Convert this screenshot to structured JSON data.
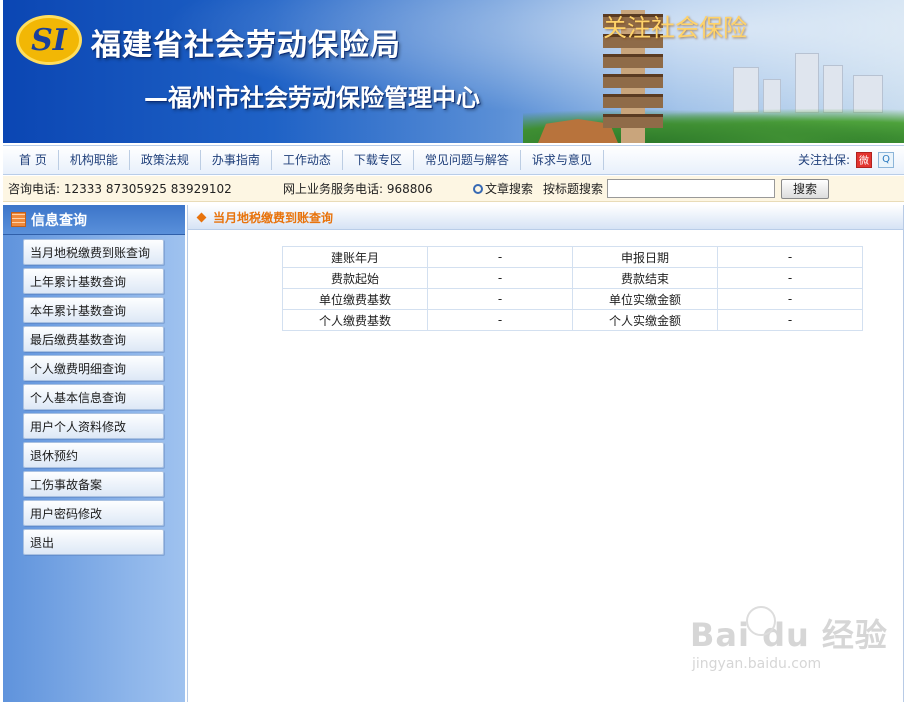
{
  "banner": {
    "logo_text": "SI",
    "title": "福建省社会劳动保险局",
    "subtitle": "—福州市社会劳动保险管理中心",
    "slogan": "关注社会保险"
  },
  "nav": {
    "items": [
      "首 页",
      "机构职能",
      "政策法规",
      "办事指南",
      "工作动态",
      "下载专区",
      "常见问题与解答",
      "诉求与意见"
    ],
    "follow_label": "关注社保:"
  },
  "info_bar": {
    "consult_phone": "咨询电话: 12333 87305925 83929102",
    "service_phone": "网上业务服务电话: 968806",
    "article_search": "文章搜索",
    "title_search_label": "按标题搜索",
    "search_value": "",
    "search_button": "搜索"
  },
  "sidebar": {
    "title": "信息查询",
    "items": [
      "当月地税缴费到账查询",
      "上年累计基数查询",
      "本年累计基数查询",
      "最后缴费基数查询",
      "个人缴费明细查询",
      "个人基本信息查询",
      "用户个人资料修改",
      "退休预约",
      "工伤事故备案",
      "用户密码修改",
      "退出"
    ]
  },
  "main": {
    "title": "当月地税缴费到账查询",
    "rows": [
      [
        "建账年月",
        "-",
        "申报日期",
        "-"
      ],
      [
        "费款起始",
        "-",
        "费款结束",
        "-"
      ],
      [
        "单位缴费基数",
        "-",
        "单位实缴金额",
        "-"
      ],
      [
        "个人缴费基数",
        "-",
        "个人实缴金额",
        "-"
      ]
    ]
  },
  "watermark": {
    "brand": "Bai du 经验",
    "url": "jingyan.baidu.com"
  }
}
